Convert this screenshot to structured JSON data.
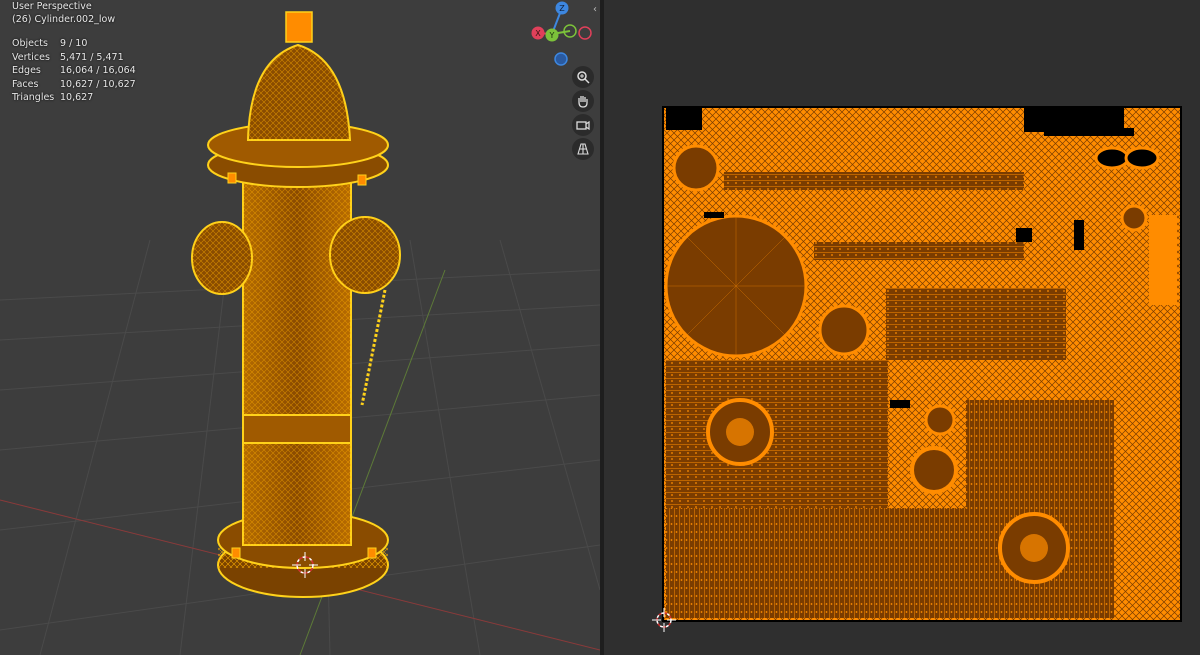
{
  "viewport": {
    "view_name": "User Perspective",
    "object_name": "(26) Cylinder.002_low",
    "stats": [
      {
        "label": "Objects",
        "value": "9 / 10"
      },
      {
        "label": "Vertices",
        "value": "5,471 / 5,471"
      },
      {
        "label": "Edges",
        "value": "16,064 / 16,064"
      },
      {
        "label": "Faces",
        "value": "10,627 / 10,627"
      },
      {
        "label": "Triangles",
        "value": "10,627"
      }
    ],
    "gizmo": {
      "z": "Z",
      "y": "Y",
      "x": "X"
    },
    "nav_icons": [
      "zoom-icon",
      "pan-hand-icon",
      "camera-icon",
      "grid-icon"
    ]
  },
  "colors": {
    "wire": "#ffd21a",
    "wire_selected": "#ff8c00",
    "uv_fill": "#ff8c00",
    "uv_island": "#7a3c00",
    "axis_x": "#e0405a",
    "axis_y": "#7cc23a",
    "axis_z": "#3d87e0"
  }
}
